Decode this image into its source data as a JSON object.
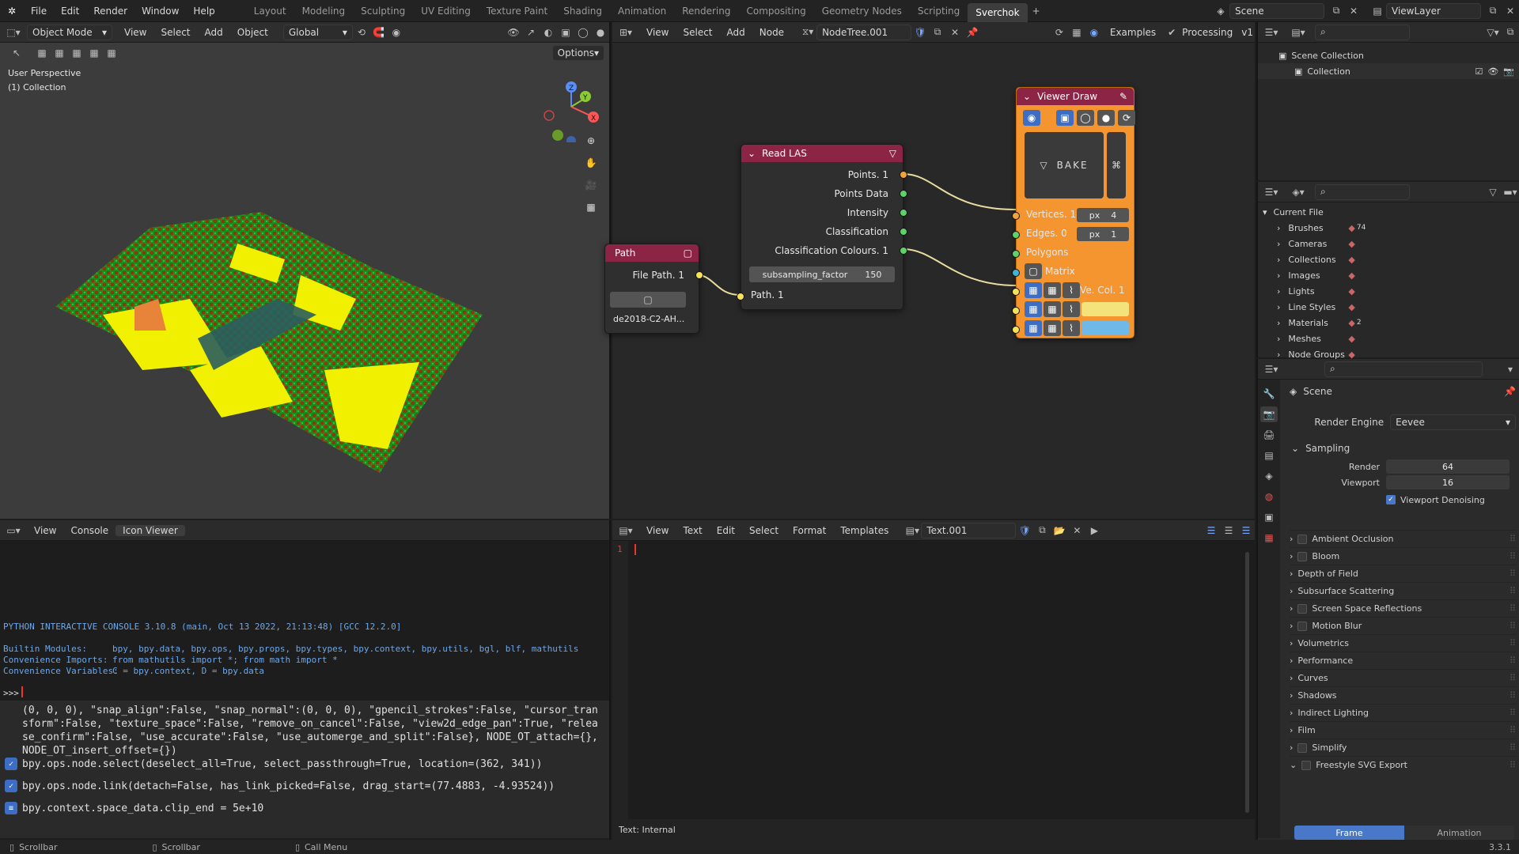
{
  "menu": [
    "File",
    "Edit",
    "Render",
    "Window",
    "Help"
  ],
  "workspaces": [
    "Layout",
    "Modeling",
    "Sculpting",
    "UV Editing",
    "Texture Paint",
    "Shading",
    "Animation",
    "Rendering",
    "Compositing",
    "Geometry Nodes",
    "Scripting",
    "Sverchok"
  ],
  "active_workspace": "Sverchok",
  "scene_name": "Scene",
  "view_layer": "ViewLayer",
  "viewport": {
    "mode": "Object Mode",
    "menus": [
      "View",
      "Select",
      "Add",
      "Object"
    ],
    "orientation": "Global",
    "options": "Options",
    "overlay_line1": "User Perspective",
    "overlay_line2": "(1) Collection"
  },
  "node_editor": {
    "menus": [
      "View",
      "Select",
      "Add",
      "Node"
    ],
    "tree_name": "NodeTree.001",
    "examples": "Examples",
    "processing": "Processing",
    "version": "v1"
  },
  "nodes": {
    "path": {
      "title": "Path",
      "output": "File Path. 1",
      "filename": "de2018-C2-AH..."
    },
    "read_las": {
      "title": "Read LAS",
      "outputs": [
        "Points. 1",
        "Points Data",
        "Intensity",
        "Classification",
        "Classification Colours. 1"
      ],
      "param_name": "subsampling_factor",
      "param_value": "150",
      "input": "Path. 1"
    },
    "viewer_draw": {
      "title": "Viewer Draw",
      "bake": "BAKE",
      "inputs": [
        "Vertices. 1",
        "Edges. 0",
        "Polygons",
        "Matrix",
        "Ve. Col. 1"
      ],
      "px_label": "px",
      "vert_size": "4",
      "edge_size": "1",
      "colors": [
        "#f4e27a",
        "#6fb9e8"
      ]
    }
  },
  "console": {
    "menus": [
      "View",
      "Console",
      "Icon Viewer"
    ],
    "banner": "PYTHON INTERACTIVE CONSOLE 3.10.8 (main, Oct 13 2022, 21:13:48) [GCC 12.2.0]",
    "builtin_label": "Builtin Modules:",
    "builtin": "bpy, bpy.data, bpy.ops, bpy.props, bpy.types, bpy.context, bpy.utils, bgl, blf, mathutils",
    "imports_label": "Convenience Imports:",
    "imports": "from mathutils import *; from math import *",
    "vars_label": "Convenience Variables:",
    "vars": "C = bpy.context, D = bpy.data",
    "prompt": ">>>",
    "history": "(0, 0, 0), \"snap_align\":False, \"snap_normal\":(0, 0, 0), \"gpencil_strokes\":False, \"cursor_transform\":False, \"texture_space\":False, \"remove_on_cancel\":False, \"view2d_edge_pan\":True, \"release_confirm\":False, \"use_accurate\":False, \"use_automerge_and_split\":False}, NODE_OT_attach={}, NODE_OT_insert_offset={})",
    "reports": [
      "bpy.ops.node.select(deselect_all=True, select_passthrough=True, location=(362, 341))",
      "bpy.ops.node.link(detach=False, has_link_picked=False, drag_start=(77.4883, -4.93524))",
      "bpy.context.space_data.clip_end = 5e+10"
    ]
  },
  "text_editor": {
    "menus": [
      "View",
      "Text",
      "Edit",
      "Select",
      "Format",
      "Templates"
    ],
    "text_name": "Text.001",
    "line_no": "1",
    "footer": "Text: Internal"
  },
  "outliner": {
    "scene_collection": "Scene Collection",
    "collection": "Collection"
  },
  "blend_file": {
    "root": "Current File",
    "items": [
      {
        "label": "Brushes",
        "icon": "brush-icon",
        "count": "74"
      },
      {
        "label": "Cameras",
        "icon": "camera-icon",
        "count": ""
      },
      {
        "label": "Collections",
        "icon": "collection-icon",
        "count": ""
      },
      {
        "label": "Images",
        "icon": "image-icon",
        "count": ""
      },
      {
        "label": "Lights",
        "icon": "light-icon",
        "count": ""
      },
      {
        "label": "Line Styles",
        "icon": "linestyle-icon",
        "count": ""
      },
      {
        "label": "Materials",
        "icon": "material-icon",
        "count": "2"
      },
      {
        "label": "Meshes",
        "icon": "mesh-icon",
        "count": ""
      },
      {
        "label": "Node Groups",
        "icon": "nodegroup-icon",
        "count": ""
      }
    ]
  },
  "properties": {
    "context": "Scene",
    "render_engine_label": "Render Engine",
    "render_engine": "Eevee",
    "sampling": "Sampling",
    "render_label": "Render",
    "render_samples": "64",
    "viewport_label": "Viewport",
    "viewport_samples": "16",
    "denoise": "Viewport Denoising",
    "panels": [
      {
        "label": "Ambient Occlusion",
        "checkbox": true
      },
      {
        "label": "Bloom",
        "checkbox": true
      },
      {
        "label": "Depth of Field",
        "checkbox": false
      },
      {
        "label": "Subsurface Scattering",
        "checkbox": false
      },
      {
        "label": "Screen Space Reflections",
        "checkbox": true
      },
      {
        "label": "Motion Blur",
        "checkbox": true
      },
      {
        "label": "Volumetrics",
        "checkbox": false
      },
      {
        "label": "Performance",
        "checkbox": false
      },
      {
        "label": "Curves",
        "checkbox": false
      },
      {
        "label": "Shadows",
        "checkbox": false
      },
      {
        "label": "Indirect Lighting",
        "checkbox": false
      },
      {
        "label": "Film",
        "checkbox": false
      },
      {
        "label": "Simplify",
        "checkbox": true
      },
      {
        "label": "Freestyle SVG Export",
        "checkbox": true
      }
    ],
    "tab_frame": "Frame",
    "tab_animation": "Animation"
  },
  "status": {
    "left": "Scrollbar",
    "middle": "Scrollbar",
    "right": "Call Menu",
    "version": "3.3.1"
  }
}
